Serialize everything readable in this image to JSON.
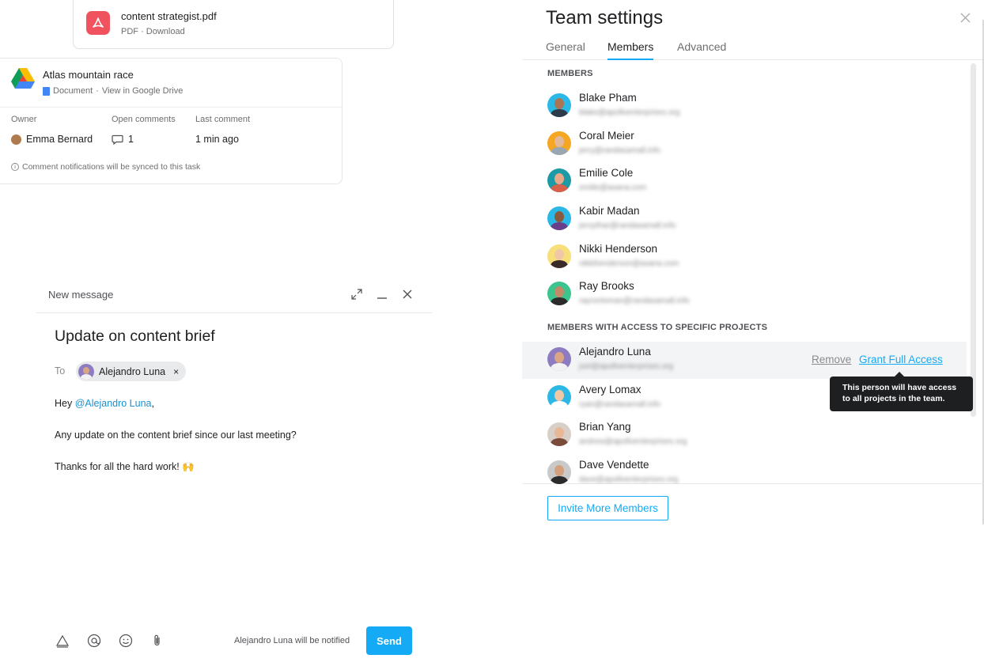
{
  "pdf_card": {
    "filename": "content strategist.pdf",
    "meta": "PDF · Download",
    "icon": "pdf-icon"
  },
  "drive_card": {
    "title": "Atlas mountain race",
    "subtitle_type": "Document",
    "subtitle_link": "View in Google Drive",
    "owner_label": "Owner",
    "owner_value": "Emma Bernard",
    "open_comments_label": "Open comments",
    "open_comments_value": "1",
    "last_comment_label": "Last comment",
    "last_comment_value": "1 min ago",
    "note": "Comment notifications will be synced to this task"
  },
  "compose": {
    "header_title": "New message",
    "subject": "Update on content brief",
    "to_label": "To",
    "recipient": "Alejandro Luna",
    "greeting": "Hey ",
    "mention": "@Alejandro Luna",
    "greeting_end": ",",
    "line2": "Any update on the content brief since our last meeting?",
    "line3": "Thanks for all the hard work! 🙌",
    "notify_text": "Alejandro Luna will be notified",
    "send_label": "Send"
  },
  "team_settings": {
    "title": "Team settings",
    "tabs": [
      {
        "label": "General",
        "active": false
      },
      {
        "label": "Members",
        "active": true
      },
      {
        "label": "Advanced",
        "active": false
      }
    ],
    "members_section_label": "MEMBERS",
    "members": [
      {
        "name": "Blake Pham",
        "email": "blake@apolloenterprises.org"
      },
      {
        "name": "Coral Meier",
        "email": "jerry@randasamall.info"
      },
      {
        "name": "Emilie Cole",
        "email": "emilie@asana.com"
      },
      {
        "name": "Kabir Madan",
        "email": "jeroythar@randasamall.info"
      },
      {
        "name": "Nikki Henderson",
        "email": "nikkihenderson@asana.com"
      },
      {
        "name": "Ray Brooks",
        "email": "rayrontoman@randasamall.info"
      }
    ],
    "specific_section_label": "MEMBERS WITH ACCESS TO SPECIFIC PROJECTS",
    "specific_members": [
      {
        "name": "Alejandro Luna",
        "email": "joel@apolloenterprises.org"
      },
      {
        "name": "Avery Lomax",
        "email": "ryan@randasamall.info"
      },
      {
        "name": "Brian Yang",
        "email": "andrew@apolloenterprises.org"
      },
      {
        "name": "Dave Vendette",
        "email": "dave@apolloenterprises.org"
      }
    ],
    "remove_label": "Remove",
    "grant_label": "Grant Full Access",
    "tooltip_line1": "This person will have access",
    "tooltip_line2": "to all projects in the team.",
    "invite_label": "Invite More Members"
  },
  "colors": {
    "accent": "#14aaf5",
    "pdf_red": "#f0535e",
    "tooltip_bg": "#1e1f21"
  }
}
